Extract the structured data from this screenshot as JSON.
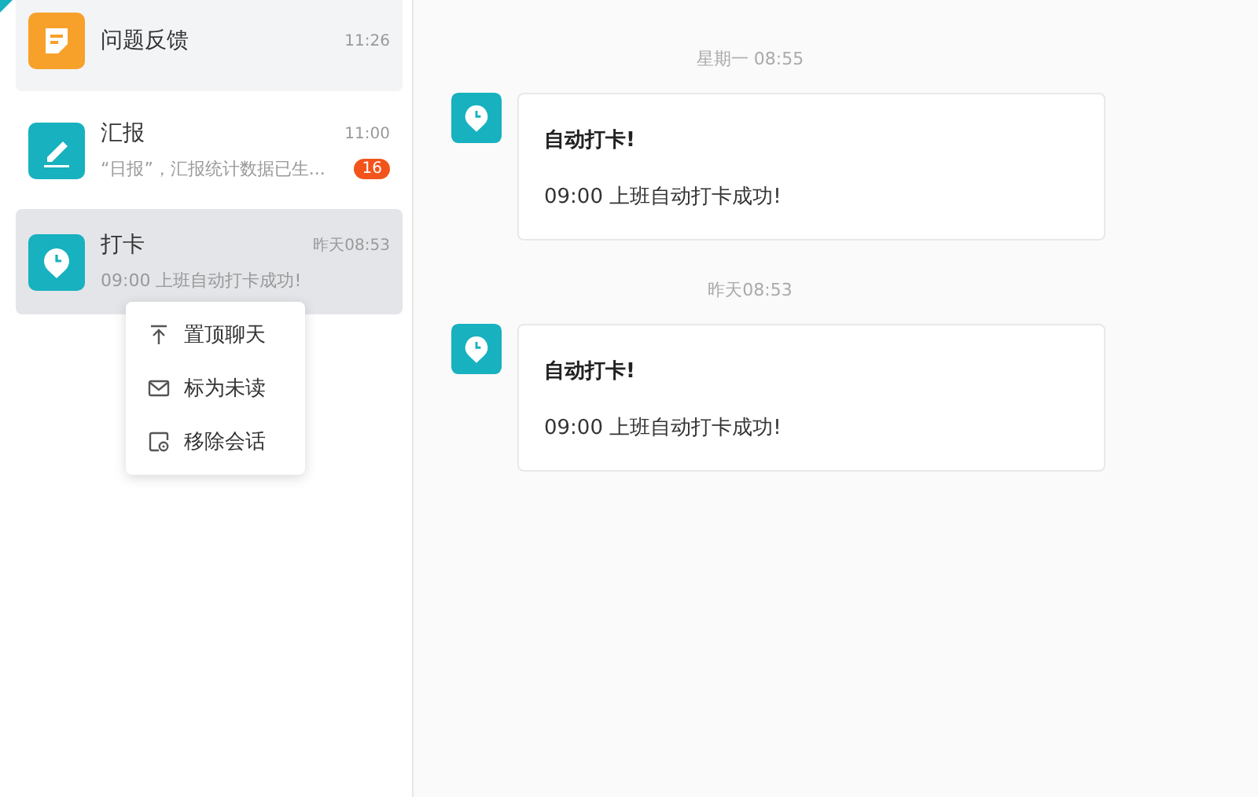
{
  "conversations": [
    {
      "kind": "feedback",
      "title": "问题反馈",
      "time": "11:26",
      "pinned": true,
      "selected": false
    },
    {
      "kind": "report",
      "title": "汇报",
      "time": "11:00",
      "preview": "“日报”，汇报统计数据已生...",
      "badge": "16",
      "pinned": false,
      "selected": false
    },
    {
      "kind": "clock",
      "title": "打卡",
      "time": "昨天08:53",
      "preview": "09:00 上班自动打卡成功!",
      "pinned": false,
      "selected": true
    }
  ],
  "context_menu": [
    {
      "kind": "pin",
      "label": "置顶聊天"
    },
    {
      "kind": "mail",
      "label": "标为未读"
    },
    {
      "kind": "remove",
      "label": "移除会话"
    }
  ],
  "messages": [
    {
      "time": "星期一 08:55",
      "title": "自动打卡!",
      "body": "09:00 上班自动打卡成功!"
    },
    {
      "time": "昨天08:53",
      "title": "自动打卡!",
      "body": "09:00 上班自动打卡成功!"
    }
  ]
}
